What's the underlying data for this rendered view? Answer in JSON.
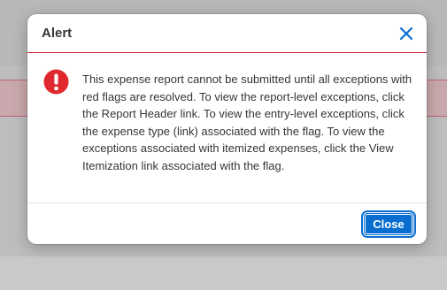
{
  "dialog": {
    "title": "Alert",
    "message": "This expense report cannot be submitted until all exceptions with red flags are resolved. To view the report-level exceptions, click the Report Header link. To view the entry-level exceptions, click the expense type (link) associated with the flag. To view the exceptions associated with itemized expenses, click the View Itemization link associated with the flag.",
    "close_button_label": "Close",
    "icons": {
      "status": "error-icon",
      "dismiss": "close-icon"
    }
  },
  "colors": {
    "error_red": "#e0292f",
    "accent_blue": "#0a6ed1",
    "header_rule": "#d32030"
  }
}
